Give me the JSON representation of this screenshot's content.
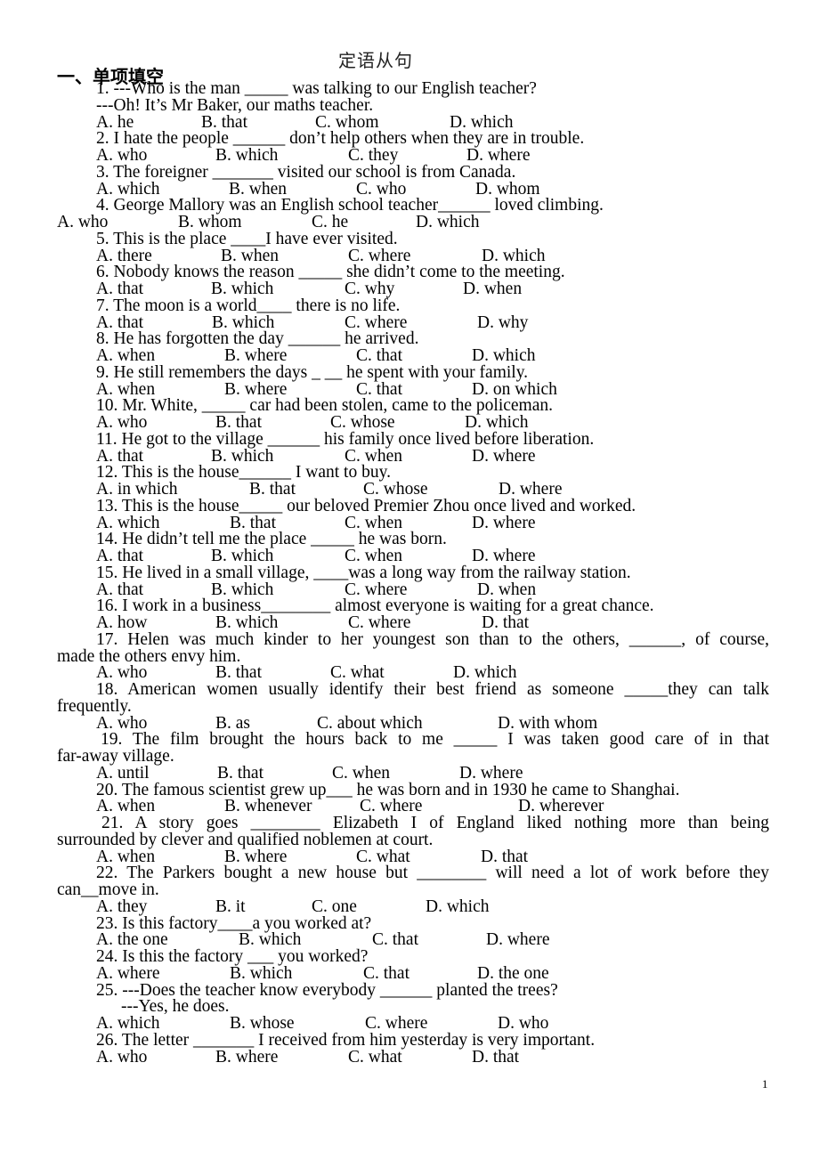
{
  "document": {
    "title": "定语从句",
    "section_heading": "一、单项填空",
    "page_number": "1"
  },
  "questions": [
    {
      "lines": [
        "1. ---Who is the man _____ was talking to our English teacher?",
        "---Oh! It’s Mr Baker, our maths teacher."
      ],
      "options": [
        "A. he",
        "B. that",
        "C. whom",
        "D. which"
      ]
    },
    {
      "lines": [
        "2. I hate the people ______ don’t help others when they are in trouble."
      ],
      "options": [
        "A. who",
        "B. which",
        "C. they",
        "D. where"
      ]
    },
    {
      "lines": [
        "3. The foreigner _______ visited our school is from Canada."
      ],
      "options": [
        "A. which",
        "B. when",
        "C. who",
        "D. whom"
      ]
    },
    {
      "lines": [
        "4. George Mallory was an English school teacher______ loved climbing."
      ],
      "options": [
        "A. who",
        "B. whom",
        "C. he",
        "D. which"
      ]
    },
    {
      "lines": [
        "5. This is the place ____I have ever visited."
      ],
      "options": [
        "A. there",
        "B. when",
        "C. where",
        "D. which"
      ]
    },
    {
      "lines": [
        "6. Nobody knows the reason _____ she didn’t come to the meeting."
      ],
      "options": [
        "A. that",
        "B. which",
        "C. why",
        "D. when"
      ]
    },
    {
      "lines": [
        "7. The moon is a world____ there is no life."
      ],
      "options": [
        "A. that",
        "B. which",
        "C. where",
        "D. why"
      ]
    },
    {
      "lines": [
        "8. He has forgotten the day ______ he arrived."
      ],
      "options": [
        "A. when",
        "B. where",
        "C. that",
        "D. which"
      ]
    },
    {
      "lines": [
        "9. He still remembers the days _ __ he spent with your family."
      ],
      "options": [
        "A. when",
        "B. where",
        "C. that",
        "D. on which"
      ]
    },
    {
      "lines": [
        "10. Mr. White, _____ car had been stolen, came to the policeman."
      ],
      "options": [
        "A. who",
        "B. that",
        "C. whose",
        "D. which"
      ]
    },
    {
      "lines": [
        "11. He got to the village ______ his family once lived before liberation."
      ],
      "options": [
        "A. that",
        "B. which",
        "C. when",
        "D. where"
      ]
    },
    {
      "lines": [
        "12. This is the house______ I want to buy."
      ],
      "options": [
        "A. in which",
        "B. that",
        "C. whose",
        "D. where"
      ]
    },
    {
      "lines": [
        "13. This is the house_____ our beloved Premier Zhou once lived and worked."
      ],
      "options": [
        "A. which",
        "B. that",
        "C. when",
        "D. where"
      ]
    },
    {
      "lines": [
        "14. He didn’t tell me the place _____ he was born."
      ],
      "options": [
        "A. that",
        "B. which",
        "C. when",
        "D. where"
      ]
    },
    {
      "lines": [
        "15. He lived in a small village, ____was a long way from the railway station."
      ],
      "options": [
        "A. that",
        "B. which",
        "C. where",
        "D. when"
      ]
    },
    {
      "lines": [
        "16. I work in a business________ almost everyone is waiting for a great chance."
      ],
      "options": [
        "A. how",
        "B. which",
        "C. where",
        "D. that"
      ]
    },
    {
      "lines": [
        "17. Helen was much kinder to her youngest son than to the others, ______, of course,",
        "made the others envy him."
      ],
      "options": [
        "A. who",
        "B. that",
        "C. what",
        "D. which"
      ]
    },
    {
      "lines": [
        "18. American women usually identify their best friend as someone _____they can talk",
        "frequently."
      ],
      "options": [
        "A. who",
        "B. as",
        "C. about which",
        "D. with whom"
      ]
    },
    {
      "lines": [
        "19. The film brought the hours back to me _____ I was taken good care of in that",
        "far-away village."
      ],
      "options": [
        "A. until",
        "B. that",
        "C. when",
        "D. where"
      ]
    },
    {
      "lines": [
        "20. The famous scientist grew up___ he was born and in 1930 he came to Shanghai."
      ],
      "options": [
        "A. when",
        "B. whenever",
        "C. where",
        "D. wherever"
      ]
    },
    {
      "lines": [
        "21. A story goes ________ Elizabeth I of England liked nothing more than being",
        "surrounded by clever and qualified noblemen at court."
      ],
      "options": [
        "A. when",
        "B. where",
        "C. what",
        "D. that"
      ]
    },
    {
      "lines": [
        "22. The Parkers bought a new house but ________ will need a lot of work before they",
        "can__move in."
      ],
      "options": [
        "A. they",
        "B. it",
        "C. one",
        "D. which"
      ]
    },
    {
      "lines": [
        "23. Is this factory____a you worked at?"
      ],
      "options": [
        "A. the one",
        "B. which",
        "C. that",
        "D. where"
      ]
    },
    {
      "lines": [
        "24. Is this the factory ___ you worked?"
      ],
      "options": [
        "A. where",
        "B. which",
        "C. that",
        "D. the one"
      ]
    },
    {
      "lines": [
        "25. ---Does the teacher know everybody ______ planted the trees?",
        "---Yes, he does."
      ],
      "options": [
        "A. which",
        "B. whose",
        "C. where",
        "D. who"
      ]
    },
    {
      "lines": [
        "26. The letter _______ I received from him yesterday is very important."
      ],
      "options": [
        "A. who",
        "B. where",
        "C. what",
        "D. that"
      ]
    }
  ]
}
